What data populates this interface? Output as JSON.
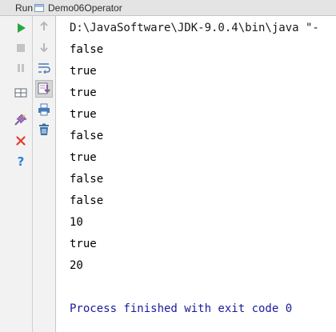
{
  "header": {
    "run_label": "Run",
    "tab_label": "Demo06Operator"
  },
  "toolbar": {
    "buttons": [
      {
        "name": "rerun-icon",
        "color": "#28a745"
      },
      {
        "name": "stop-icon",
        "color": "#b0b0b0"
      },
      {
        "name": "pause-icon",
        "color": "#b0b0b0"
      },
      {
        "name": "dump-threads-icon",
        "color": "#5a6a7a"
      },
      {
        "name": "pin-icon",
        "color": "#8e44ad"
      },
      {
        "name": "close-icon",
        "color": "#e03c31"
      },
      {
        "name": "help-icon",
        "color": "#2f7ed8"
      },
      {
        "name": "up-arrow-icon",
        "color": "#b8b8b8"
      },
      {
        "name": "down-arrow-icon",
        "color": "#b8b8b8"
      },
      {
        "name": "soft-wrap-icon",
        "color": "#4a7ab8"
      },
      {
        "name": "scroll-to-end-icon",
        "color": "#8a5a9a"
      },
      {
        "name": "print-icon",
        "color": "#4a7ab8"
      },
      {
        "name": "clear-all-icon",
        "color": "#3a6ea8"
      }
    ]
  },
  "console": {
    "command": "D:\\JavaSoftware\\JDK-9.0.4\\bin\\java \"-",
    "output": [
      "false",
      "true",
      "true",
      "true",
      "false",
      "true",
      "false",
      "false",
      "10",
      "true",
      "20"
    ],
    "exit_message": "Process finished with exit code 0"
  }
}
